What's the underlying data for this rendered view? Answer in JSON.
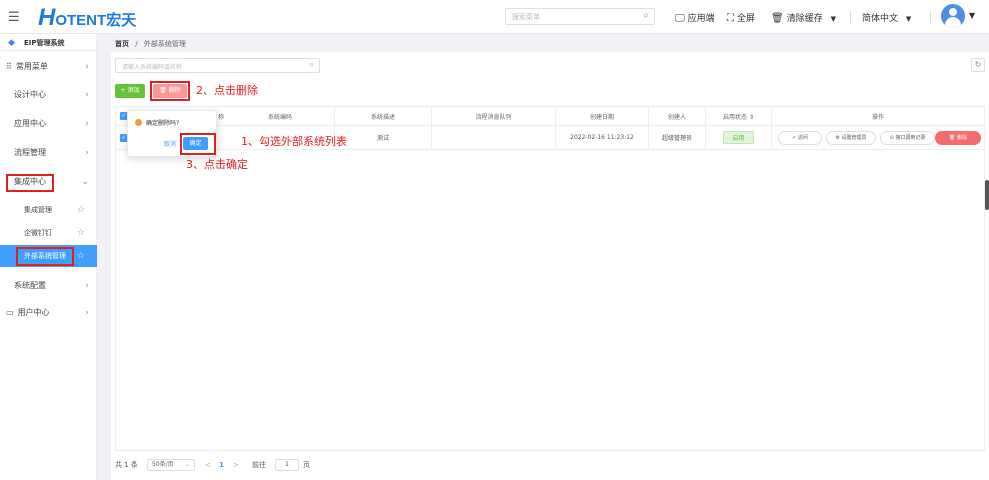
{
  "header": {
    "logo_letter": "H",
    "logo_rest": "OTENT",
    "logo_cn": "宏天",
    "search_placeholder": "搜索菜单",
    "app_label": "应用端",
    "fullscreen_label": "全屏",
    "clear_cache_label": "清除缓存",
    "language_label": "简体中文"
  },
  "sidebar": {
    "title": "EIP管理系统",
    "items": [
      {
        "label": "常用菜单"
      },
      {
        "label": "设计中心"
      },
      {
        "label": "应用中心"
      },
      {
        "label": "流程管理"
      },
      {
        "label": "集成中心"
      },
      {
        "label": "系统配置"
      },
      {
        "label": "用户中心"
      }
    ],
    "sub_items": [
      {
        "label": "集成管理"
      },
      {
        "label": "企微钉钉"
      },
      {
        "label": "外部系统管理"
      }
    ]
  },
  "breadcrumb": {
    "home": "首页",
    "sep": "/",
    "current": "外部系统管理"
  },
  "filter": {
    "placeholder": "请输入系统编码或名称"
  },
  "toolbar": {
    "add_label": "+ 添加",
    "delete_label": "🗑 删除"
  },
  "annotations": {
    "step1": "1、勾选外部系统列表",
    "step2": "2、点击删除",
    "step3": "3、点击确定"
  },
  "table": {
    "headers": [
      "称",
      "系统编码",
      "系统描述",
      "流程消息队列",
      "创建日期",
      "创建人",
      "启用状态 ⇕",
      "操作"
    ],
    "row": {
      "desc": "测试",
      "created": "2022-02-16 11:23:12",
      "creator": "超级管理员",
      "status": "启用"
    },
    "ops": [
      "✓ 访问",
      "⚙ 设置管理员",
      "⊙ 接口调用记录",
      "🗑 删除"
    ]
  },
  "popconfirm": {
    "question": "确定删除吗?",
    "cancel": "取消",
    "ok": "确定"
  },
  "pagination": {
    "total": "共 1 条",
    "page_size": "50条/页",
    "prev": "<",
    "current_page": "1",
    "next": ">",
    "goto_label": "前往",
    "goto_value": "1",
    "page_unit": "页"
  }
}
